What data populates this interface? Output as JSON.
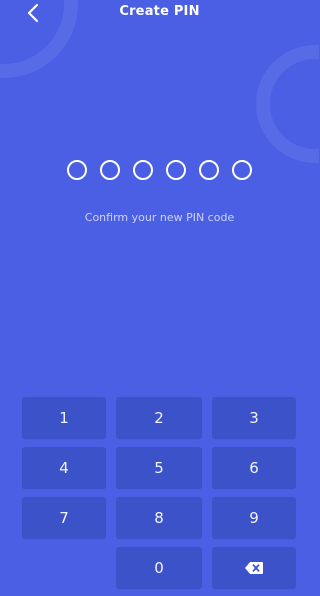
{
  "colors": {
    "background": "#4a5fe4",
    "key_background": "#3c52c9",
    "text": "#ffffff"
  },
  "header": {
    "title": "Create PIN",
    "back_icon": "chevron-left-icon"
  },
  "pin": {
    "length": 6,
    "filled": 0
  },
  "subtitle": "Confirm your new PIN code",
  "keypad": {
    "keys": [
      "1",
      "2",
      "3",
      "4",
      "5",
      "6",
      "7",
      "8",
      "9",
      "",
      "0",
      ""
    ],
    "delete_icon": "backspace-icon"
  }
}
